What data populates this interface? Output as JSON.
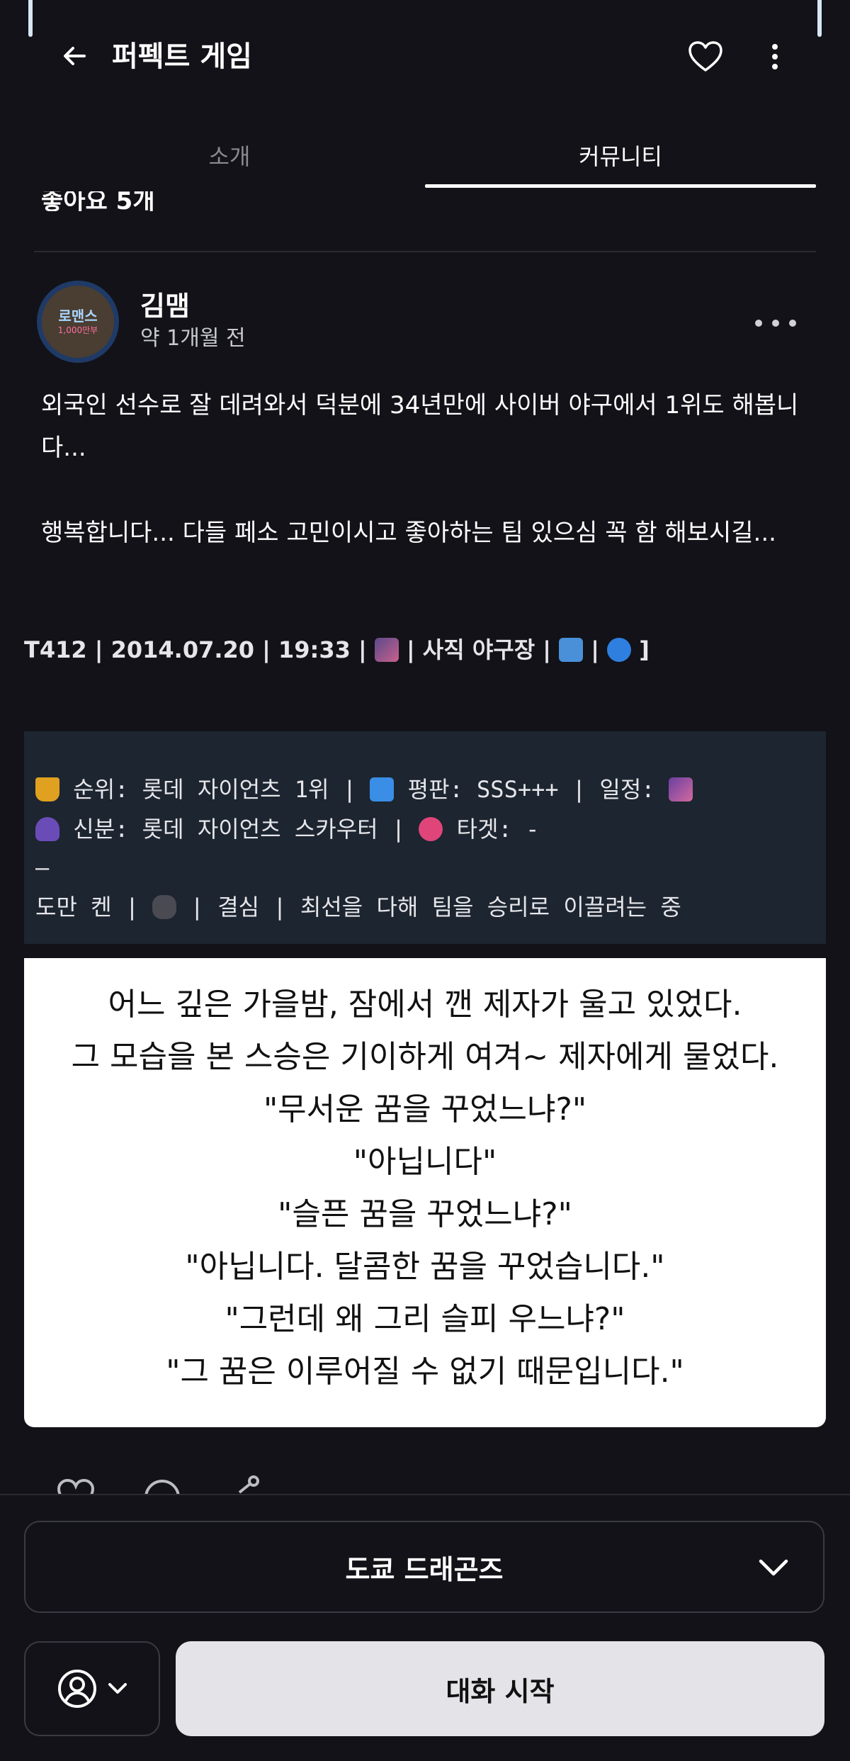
{
  "header": {
    "title": "퍼펙트 게임",
    "back_icon": "arrow-left-icon",
    "favorite_icon": "heart-outline-icon",
    "more_icon": "more-vertical-icon"
  },
  "tabs": [
    {
      "label": "소개",
      "active": false
    },
    {
      "label": "커뮤니티",
      "active": true
    }
  ],
  "previous_post": {
    "likes_text": "좋아요 5개"
  },
  "post": {
    "author": "김맴",
    "time": "약 1개월 전",
    "avatar_text": {
      "line1": "로맨스",
      "line2": "1,000만부"
    },
    "body": "외국인 선수로 잘 데려와서 덕분에 34년만에 사이버 야구에서 1위도 해봅니다...\n\n행복합니다... 다들 페소 고민이시고 좋아하는 팀 있으심 꼭 함 해보시길...",
    "status_line": {
      "part1": "T412 | 2014.07.20 | 19:33 | ",
      "part2": " | 사직 야구장 | ",
      "part3": " | ",
      "part4": " ]"
    },
    "status_panel": {
      "line1_a": " 순위: 롯데 자이언츠 1위 | ",
      "line1_b": " 평판: SSS+++ | 일정: ",
      "line2_a": " 신분: 롯데 자이언츠 스카우터 | ",
      "line2_b": " 타겟: -",
      "line3": "—",
      "line4_a": "도만 켄 | ",
      "line4_b": " | 결심 | 최선을 다해 팀을 승리로 이끌려는 중"
    },
    "story_lines": [
      "어느 깊은 가을밤, 잠에서 깬 제자가 울고 있었다.",
      "그 모습을 본 스승은 기이하게 여겨~ 제자에게 물었다.",
      "\"무서운 꿈을 꾸었느냐?\"",
      "\"아닙니다\"",
      "\"슬픈 꿈을 꾸었느냐?\"",
      "\"아닙니다. 달콤한 꿈을 꾸었습니다.\"",
      "\"그런데 왜 그리 슬피 우느냐?\"",
      "\"그 꿈은 이루어질 수 없기 때문입니다.\""
    ]
  },
  "bottom": {
    "character_select": "도쿄 드래곤즈",
    "start_button": "대화 시작",
    "persona_icon": "user-circle-icon"
  }
}
